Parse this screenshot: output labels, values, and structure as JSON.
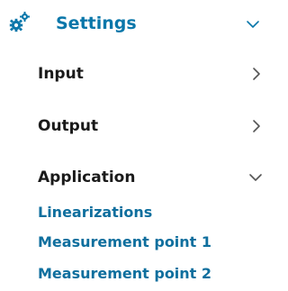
{
  "menu": {
    "header": {
      "label": "Settings",
      "icon": "gear-icon",
      "state_icon": "chevron-down-icon"
    },
    "items": [
      {
        "label": "Input",
        "state_icon": "chevron-right-icon"
      },
      {
        "label": "Output",
        "state_icon": "chevron-right-icon"
      },
      {
        "label": "Application",
        "state_icon": "chevron-down-icon",
        "children": [
          {
            "label": "Linearizations"
          },
          {
            "label": "Measurement point 1"
          },
          {
            "label": "Measurement point 2"
          }
        ]
      }
    ]
  },
  "colors": {
    "accent": "#0a77aa",
    "link": "#0f6f9e",
    "text": "#1a1a1a",
    "chevron": "#555555"
  }
}
